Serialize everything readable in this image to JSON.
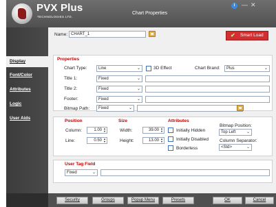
{
  "titlebar": {
    "logo_name": "PVX Plus",
    "logo_sub": "TECHNOLOGIES LTD.",
    "title": "Chart Properties",
    "info_icon": "i",
    "min": "—",
    "close": "✕"
  },
  "sidebar": {
    "items": [
      {
        "label": "Display"
      },
      {
        "label": "Font/Color"
      },
      {
        "label": "Attributes"
      },
      {
        "label": "Logic"
      },
      {
        "label": "User Aids"
      }
    ]
  },
  "header": {
    "name_label": "Name:",
    "name_value": "CHART_1",
    "smart_load": "Smart Load"
  },
  "properties": {
    "title": "Properties",
    "chart_type_label": "Chart Type:",
    "chart_type_value": "Line",
    "effect3d_label": "3D Effect",
    "chart_brand_label": "Chart Brand:",
    "chart_brand_value": "Plus",
    "title1_label": "Title 1:",
    "title1_value": "Fixed",
    "title2_label": "Title 2:",
    "title2_value": "Fixed",
    "footer_label": "Footer:",
    "footer_value": "Fixed",
    "bitmap_label": "Bitmap Path:",
    "bitmap_value": "Fixed"
  },
  "position": {
    "title": "Position",
    "column_label": "Column:",
    "column_value": "1.00",
    "line_label": "Line:",
    "line_value": "0.50"
  },
  "size": {
    "title": "Size",
    "width_label": "Width:",
    "width_value": "39.00",
    "height_label": "Height:",
    "height_value": "13.00"
  },
  "attributes": {
    "title": "Attributes",
    "hidden_label": "Initially Hidden",
    "disabled_label": "Initially Disabled",
    "borderless_label": "Borderless",
    "bitmap_position_label": "Bitmap Position:",
    "bitmap_position_value": "Top Left",
    "column_separator_label": "Column Separator:",
    "column_separator_value": "<Std>"
  },
  "user_tag": {
    "title": "User Tag Field",
    "value": "Fixed"
  },
  "footer": {
    "buttons": [
      {
        "label": "Security"
      },
      {
        "label": "Groups"
      },
      {
        "label": "Popup Menu"
      },
      {
        "label": "Presets"
      },
      {
        "label": "OK"
      },
      {
        "label": "Cancel"
      }
    ]
  },
  "colors": {
    "accent": "#c00000",
    "sidebar": "#404040",
    "smart_load": "#d23030"
  }
}
